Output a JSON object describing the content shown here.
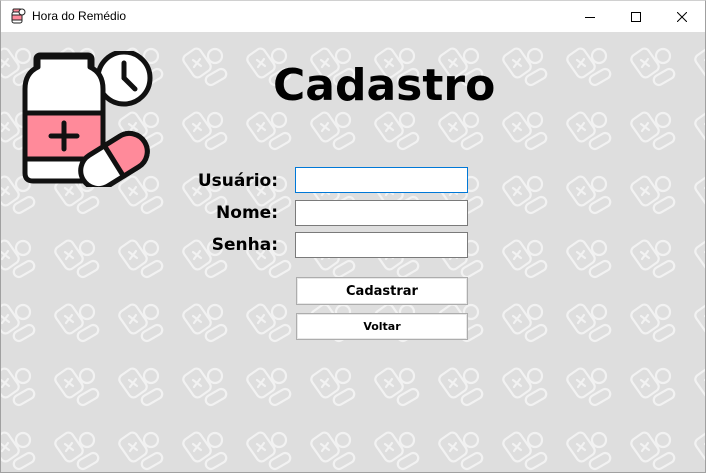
{
  "window": {
    "title": "Hora do Remédio",
    "controls": {
      "minimize": "minimize-icon",
      "maximize": "maximize-icon",
      "close": "close-icon"
    }
  },
  "form": {
    "heading": "Cadastro",
    "fields": [
      {
        "label": "Usuário:",
        "value": ""
      },
      {
        "label": "Nome:",
        "value": ""
      },
      {
        "label": "Senha:",
        "value": ""
      }
    ],
    "buttons": {
      "submit": "Cadastrar",
      "back": "Voltar"
    }
  },
  "colors": {
    "accent_pink": "#ff8a9a",
    "outline": "#111111",
    "background": "#dedede",
    "focus_border": "#0078d7"
  }
}
